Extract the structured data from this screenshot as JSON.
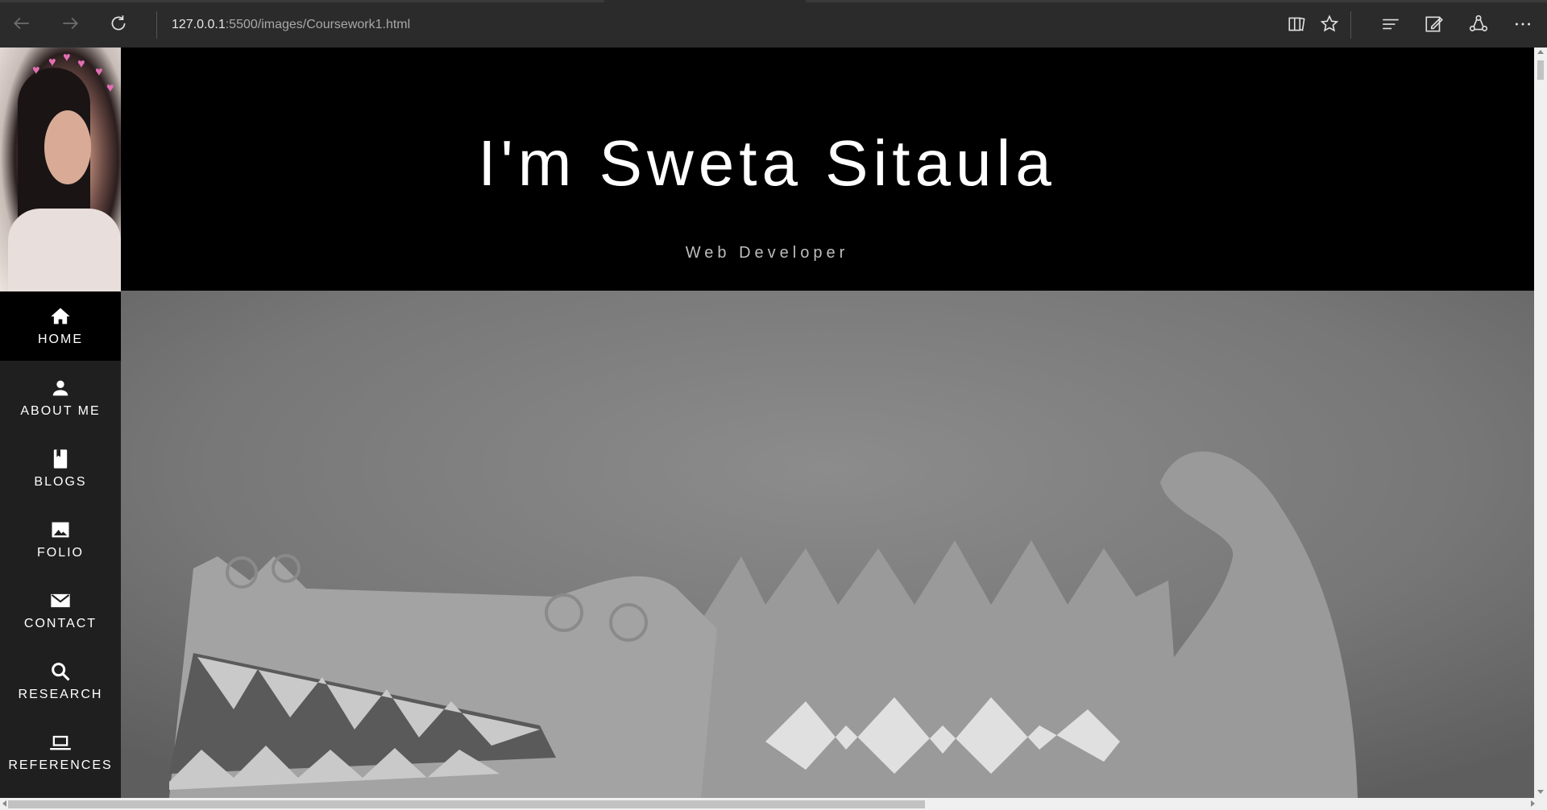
{
  "browser": {
    "url_host": "127.0.0.1",
    "url_rest": ":5500/images/Coursework1.html",
    "icons": {
      "back": "back-arrow-icon",
      "forward": "forward-arrow-icon",
      "refresh": "refresh-icon",
      "reading_view": "reading-view-icon",
      "favorite": "star-icon",
      "hub": "hub-icon",
      "web_note": "web-note-icon",
      "share": "share-icon",
      "more": "more-icon"
    }
  },
  "hero": {
    "title": "I'm Sweta Sitaula",
    "subtitle": "Web Developer"
  },
  "sidebar": {
    "items": [
      {
        "label": "HOME",
        "icon": "home-icon",
        "active": true
      },
      {
        "label": "ABOUT ME",
        "icon": "person-icon",
        "active": false
      },
      {
        "label": "BLOGS",
        "icon": "book-icon",
        "active": false
      },
      {
        "label": "FOLIO",
        "icon": "image-icon",
        "active": false
      },
      {
        "label": "CONTACT",
        "icon": "mail-icon",
        "active": false
      },
      {
        "label": "RESEARCH",
        "icon": "search-icon",
        "active": false
      },
      {
        "label": "REFERENCES",
        "icon": "laptop-icon",
        "active": false
      }
    ]
  },
  "colors": {
    "chrome_bg": "#2b2b2b",
    "sidebar_bg": "#1f1f1f",
    "hero_bg": "#000000",
    "text": "#ffffff"
  }
}
